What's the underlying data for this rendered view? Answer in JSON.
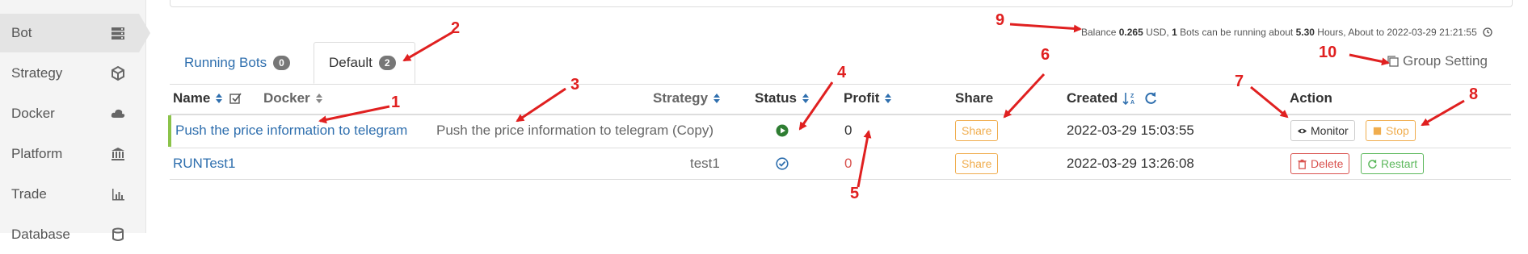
{
  "sidebar": {
    "items": [
      {
        "label": "Bot",
        "icon": "server-icon",
        "active": true
      },
      {
        "label": "Strategy",
        "icon": "cube-icon"
      },
      {
        "label": "Docker",
        "icon": "cloud-icon"
      },
      {
        "label": "Platform",
        "icon": "bank-icon"
      },
      {
        "label": "Trade",
        "icon": "bar-chart-icon"
      },
      {
        "label": "Database",
        "icon": "database-icon"
      }
    ]
  },
  "balance": {
    "prefix": "Balance",
    "amount": "0.265",
    "currency": "USD,",
    "bots_count": "1",
    "bots_text": "Bots can be running about",
    "hours": "5.30",
    "hours_text": "Hours, About to 2022-03-29 21:21:55"
  },
  "tabs": [
    {
      "label": "Running Bots",
      "count": "0"
    },
    {
      "label": "Default",
      "count": "2",
      "active": true
    }
  ],
  "group_setting_label": "Group Setting",
  "table": {
    "headers": {
      "name": "Name",
      "docker": "Docker",
      "strategy": "Strategy",
      "status": "Status",
      "profit": "Profit",
      "share": "Share",
      "created": "Created",
      "action": "Action"
    },
    "rows": [
      {
        "name": "Push the price information to telegram",
        "strategy": "Push the price information to telegram (Copy)",
        "status": "running",
        "profit": "0",
        "share": "Share",
        "created": "2022-03-29 15:03:55",
        "actions": [
          "Monitor",
          "Stop"
        ]
      },
      {
        "name": "RUNTest1",
        "strategy": "test1",
        "status": "stopped",
        "profit": "0",
        "share": "Share",
        "created": "2022-03-29 13:26:08",
        "actions": [
          "Delete",
          "Restart"
        ]
      }
    ]
  },
  "annotations": [
    "1",
    "2",
    "3",
    "4",
    "5",
    "6",
    "7",
    "8",
    "9",
    "10"
  ],
  "colors": {
    "link": "#2f6fae",
    "success": "#5cb85c",
    "warning": "#f0ad4e",
    "danger": "#d9534f",
    "annotation": "#e02020"
  }
}
